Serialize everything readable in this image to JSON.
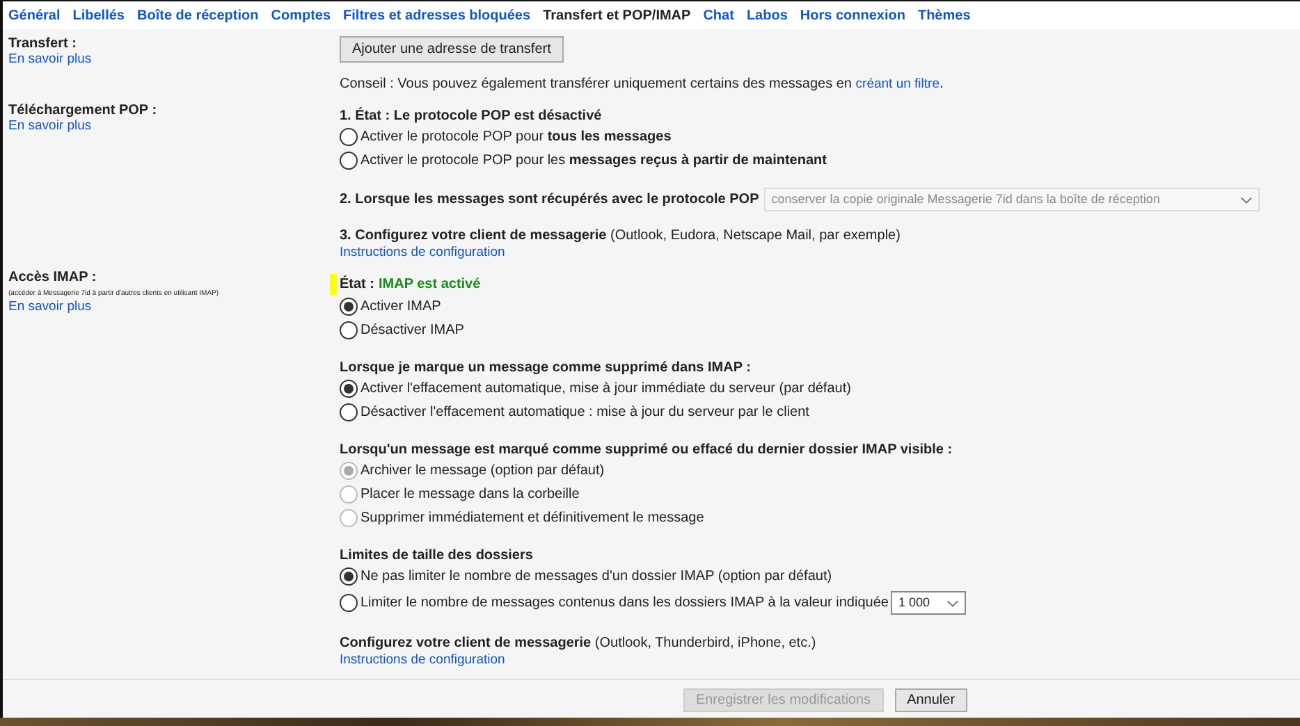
{
  "tabs": [
    {
      "label": "Général",
      "selected": false
    },
    {
      "label": "Libellés",
      "selected": false
    },
    {
      "label": "Boîte de réception",
      "selected": false
    },
    {
      "label": "Comptes",
      "selected": false
    },
    {
      "label": "Filtres et adresses bloquées",
      "selected": false
    },
    {
      "label": "Transfert et POP/IMAP",
      "selected": true
    },
    {
      "label": "Chat",
      "selected": false
    },
    {
      "label": "Labos",
      "selected": false
    },
    {
      "label": "Hors connexion",
      "selected": false
    },
    {
      "label": "Thèmes",
      "selected": false
    }
  ],
  "sections": [
    {
      "title": "Transfert :",
      "link": "En savoir plus",
      "groups": [
        [
          {
            "kind": "button",
            "label": "Ajouter une adresse de transfert"
          }
        ],
        [
          {
            "kind": "note",
            "text": "Conseil : Vous pouvez également transférer uniquement certains des messages en ",
            "link": "créant un filtre",
            "after": "."
          }
        ]
      ]
    },
    {
      "title": "Téléchargement POP :",
      "link": "En savoir plus",
      "groups": [
        [
          {
            "kind": "heading",
            "text": "1. État : Le protocole POP est désactivé"
          },
          {
            "kind": "radio",
            "text": "Activer le protocole POP pour **tous les messages**",
            "selected": false,
            "disabled": false
          },
          {
            "kind": "radio",
            "text": "Activer le protocole POP pour les **messages reçus à partir de maintenant**",
            "selected": false,
            "disabled": false
          }
        ],
        [
          {
            "kind": "select",
            "label": "2. Lorsque les messages sont récupérés avec le protocole POP",
            "value": "conserver la copie originale Messagerie 7id dans la boîte de réception",
            "disabled": true
          }
        ],
        [
          {
            "kind": "config",
            "text": "**3. Configurez votre client de messagerie** (Outlook, Eudora, Netscape Mail, par exemple)",
            "link": "Instructions de configuration"
          }
        ]
      ]
    },
    {
      "title": "Accès IMAP :",
      "subtitle": "(accéder à Messagerie 7id à partir d'autres clients en utilisant IMAP)",
      "link": "En savoir plus",
      "groups": [
        [
          {
            "kind": "status",
            "label": "État :",
            "status": "IMAP est activé",
            "marked": true
          },
          {
            "kind": "radio",
            "text": "Activer IMAP",
            "selected": true,
            "disabled": false
          },
          {
            "kind": "radio",
            "text": "Désactiver IMAP",
            "selected": false,
            "disabled": false
          }
        ],
        [
          {
            "kind": "heading",
            "text": "Lorsque je marque un message comme supprimé dans IMAP :"
          },
          {
            "kind": "radio",
            "text": "Activer l'effacement automatique, mise à jour immédiate du serveur (par défaut)",
            "selected": true,
            "disabled": false
          },
          {
            "kind": "radio",
            "text": "Désactiver l'effacement automatique : mise à jour du serveur par le client",
            "selected": false,
            "disabled": false
          }
        ],
        [
          {
            "kind": "heading",
            "text": "Lorsqu'un message est marqué comme supprimé ou effacé du dernier dossier IMAP visible :"
          },
          {
            "kind": "radio",
            "text": "Archiver le message (option par défaut)",
            "selected": true,
            "disabled": true
          },
          {
            "kind": "radio",
            "text": "Placer le message dans la corbeille",
            "selected": false,
            "disabled": true
          },
          {
            "kind": "radio",
            "text": "Supprimer immédiatement et définitivement le message",
            "selected": false,
            "disabled": true
          }
        ],
        [
          {
            "kind": "heading",
            "text": "Limites de taille des dossiers"
          },
          {
            "kind": "radio",
            "text": "Ne pas limiter le nombre de messages d'un dossier IMAP (option par défaut)",
            "selected": true,
            "disabled": false
          },
          {
            "kind": "radio",
            "text": "Limiter le nombre de messages contenus dans les dossiers IMAP à la valeur indiquée",
            "selected": false,
            "disabled": false,
            "select": "1 000"
          }
        ],
        [
          {
            "kind": "config",
            "text": "**Configurez votre client de messagerie** (Outlook, Thunderbird, iPhone, etc.)",
            "link": "Instructions de configuration"
          }
        ]
      ]
    }
  ],
  "footer": {
    "save": {
      "label": "Enregistrer les modifications",
      "disabled": true
    },
    "cancel": {
      "label": "Annuler",
      "disabled": false
    }
  }
}
